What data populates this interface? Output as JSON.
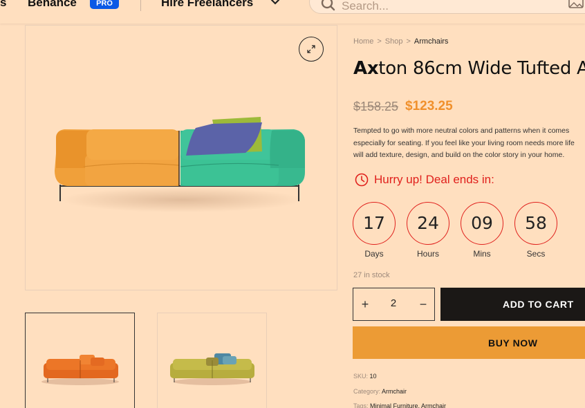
{
  "nav": {
    "edge_text": "s",
    "behance": "Behance",
    "pro": "PRO",
    "hire": "Hire Freelancers",
    "search_placeholder": "Search..."
  },
  "breadcrumb": {
    "home": "Home",
    "shop": "Shop",
    "current": "Armchairs",
    "sep": ">"
  },
  "product": {
    "title_bold": "Ax",
    "title_rest": "ton 86cm Wide Tufted A",
    "old_price": "$158.25",
    "new_price": "$123.25",
    "description_lines": [
      "Tempted to go with more neutral colors and patterns when it comes",
      "especially for seating. If you feel like your living room needs more life",
      "will add texture, design, and build on the color story in your home."
    ]
  },
  "deal": {
    "label": "Hurry up! Deal ends in:",
    "days": "17",
    "days_label": "Days",
    "hours": "24",
    "hours_label": "Hours",
    "mins": "09",
    "mins_label": "Mins",
    "secs": "58",
    "secs_label": "Secs"
  },
  "stock": "27 in stock",
  "cart": {
    "quantity": "2",
    "plus": "+",
    "minus": "−",
    "add_label": "ADD TO CART",
    "buy_label": "BUY NOW"
  },
  "meta": {
    "sku_label": "SKU:",
    "sku_value": "10",
    "category_label": "Category:",
    "category_value": "Armchair",
    "tags_label": "Tags:",
    "tags_value": "Minimal Furniture, Armchair"
  },
  "colors": {
    "accent": "#ec9b35",
    "price": "#f0902c",
    "deal_red": "#e0201c",
    "dark_button": "#1b1816",
    "background": "#ffdfbf",
    "pro_badge": "#0a59e6"
  }
}
